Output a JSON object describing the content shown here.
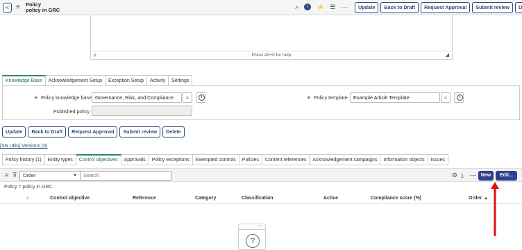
{
  "header": {
    "title_line1": "Policy",
    "title_line2": "policy in GRC",
    "buttons": [
      "Update",
      "Back to Draft",
      "Request Approval",
      "Submit review",
      "Delete"
    ]
  },
  "editor": {
    "path_label": "p",
    "hint": "Press Alt+0 for help"
  },
  "form_tabs": [
    "Knowledge Base",
    "Acknowledgement Setup",
    "Exception Setup",
    "Activity",
    "Settings"
  ],
  "form": {
    "knowledge_base_label": "Policy knowledge base",
    "knowledge_base_value": "Governance, Risk, and Compliance",
    "published_policy_label": "Published policy",
    "published_policy_value": "",
    "template_label": "Policy template",
    "template_value": "Example Article Template"
  },
  "action_buttons": [
    "Update",
    "Back to Draft",
    "Request Approval",
    "Submit review",
    "Delete"
  ],
  "versions_link": "[SN Utils] Versions (0)",
  "related_tabs": [
    "Policy history (1)",
    "Entity types",
    "Control objectives",
    "Approvals",
    "Policy exceptions",
    "Exempted controls",
    "Policies",
    "Content references",
    "Acknowledgement campaigns",
    "Information objects",
    "Issues"
  ],
  "list": {
    "select_value": "Order",
    "search_placeholder": "Search",
    "new_label": "New",
    "edit_label": "Edit...",
    "filter_text": "Policy = policy in GRC",
    "columns": [
      "Control objective",
      "Reference",
      "Category",
      "Classification",
      "Active",
      "Compliance score (%)",
      "Order"
    ],
    "sort_indicator": "▲"
  },
  "colors": {
    "accent": "#2e4a7a",
    "primary_button": "#2e3f8f",
    "active_tab": "#2b8a65",
    "arrow": "#e01010"
  }
}
